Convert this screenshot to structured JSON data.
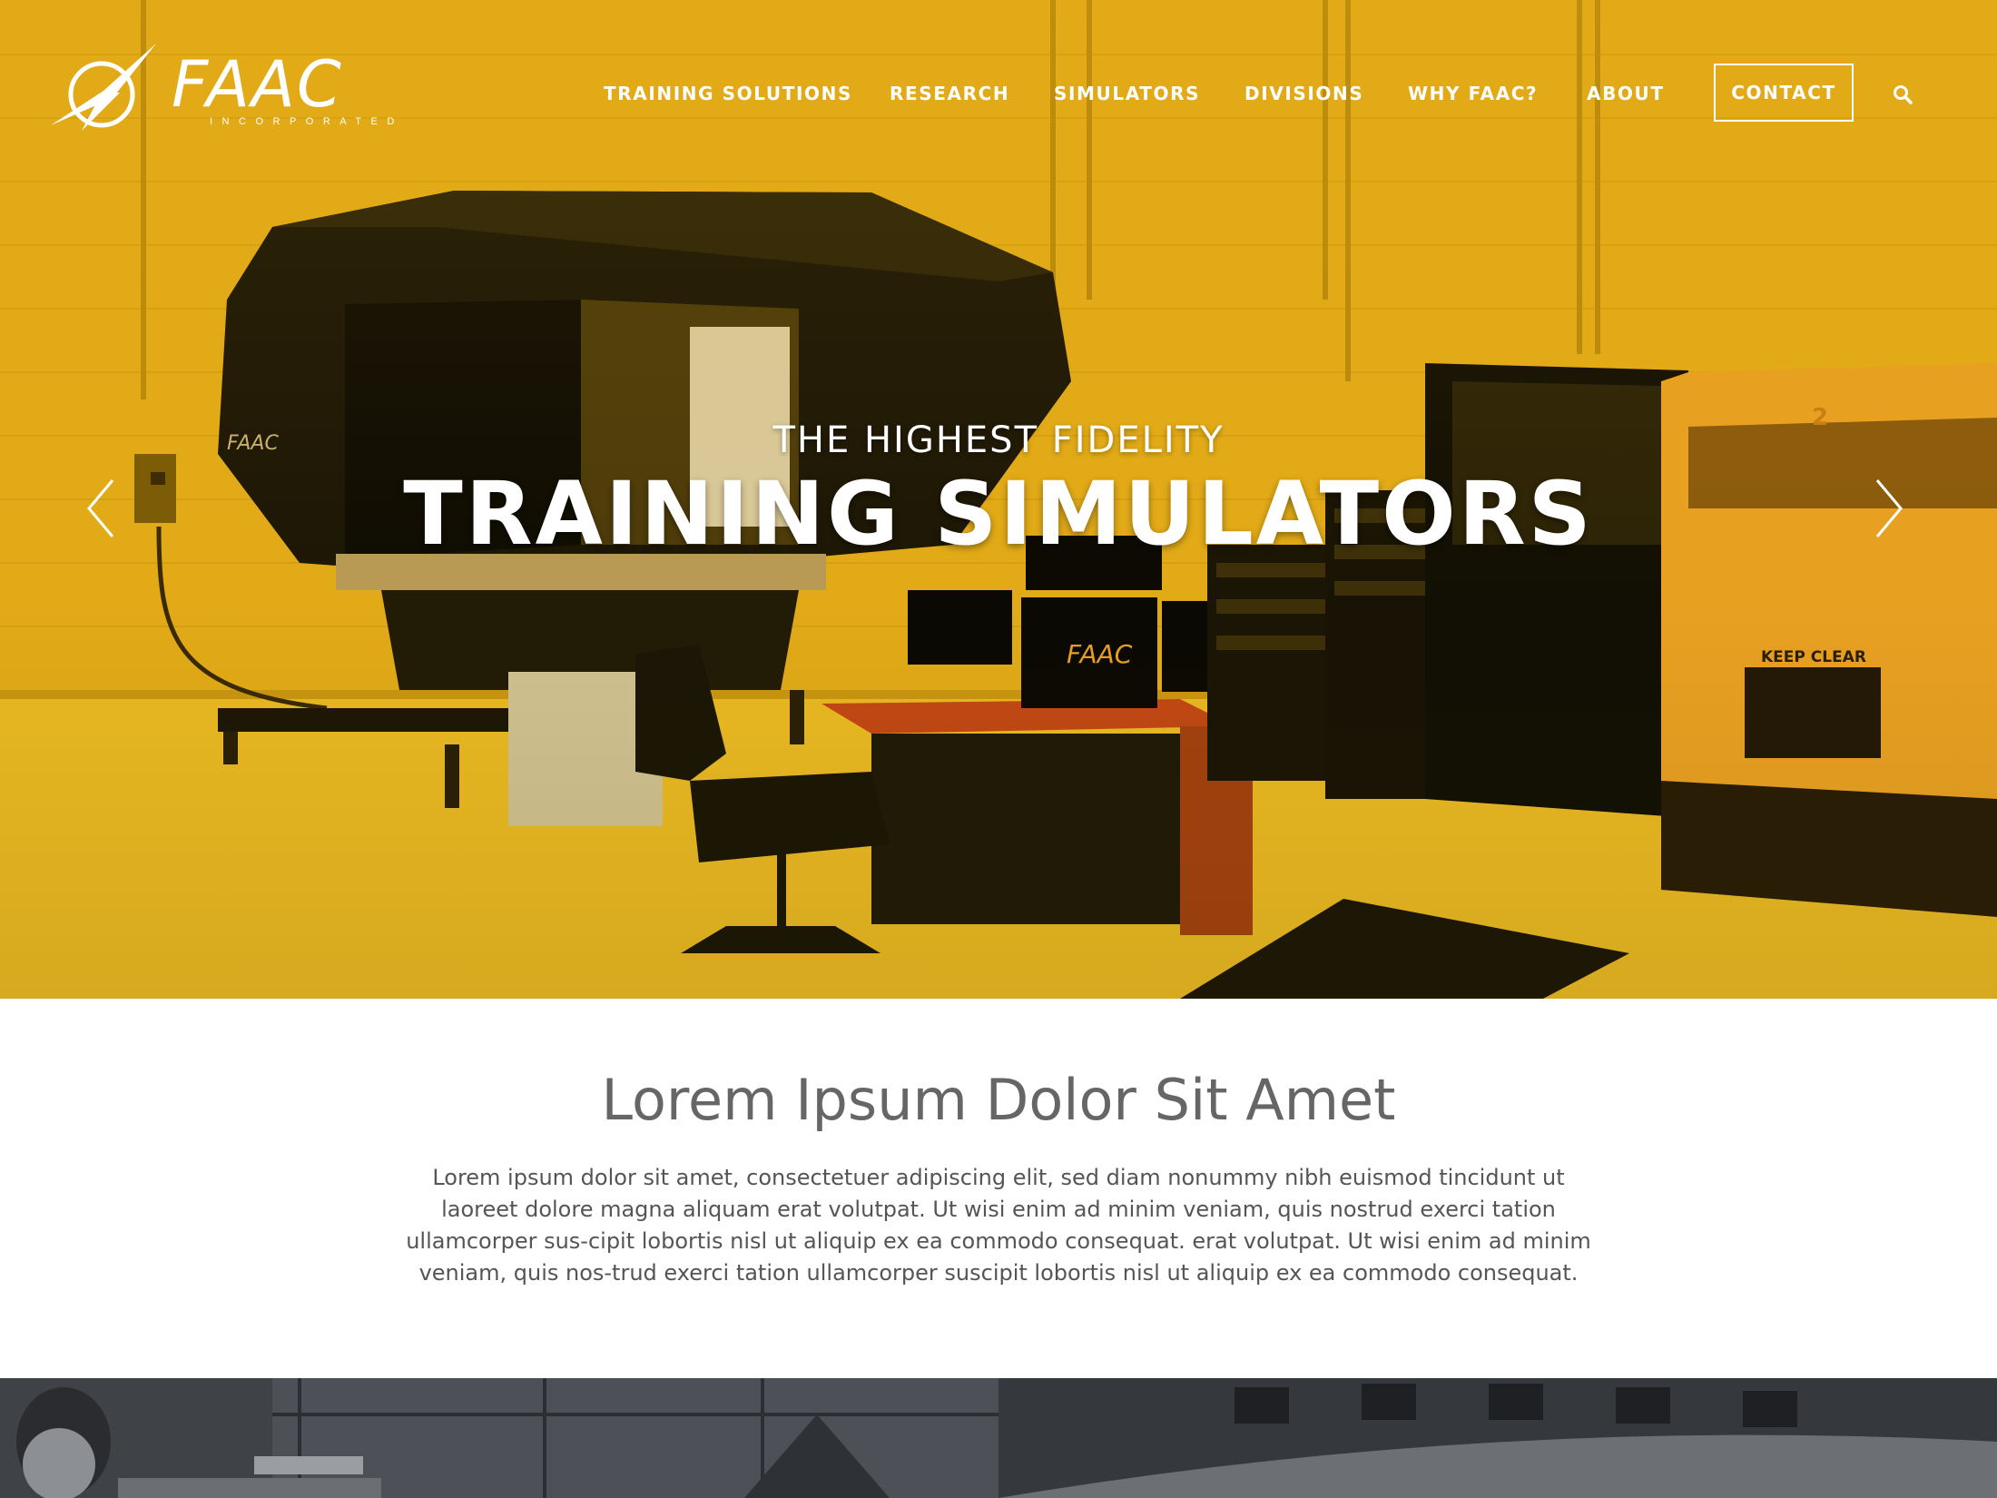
{
  "brand": {
    "name": "FAAC",
    "subtitle": "INCORPORATED"
  },
  "nav": {
    "items": [
      "TRAINING SOLUTIONS",
      "RESEARCH",
      "SIMULATORS",
      "DIVISIONS",
      "WHY FAAC?",
      "ABOUT"
    ],
    "contact_label": "CONTACT"
  },
  "hero": {
    "kicker": "THE HIGHEST FIDELITY",
    "title": "TRAINING SIMULATORS",
    "prev_icon": "chevron-left-icon",
    "next_icon": "chevron-right-icon",
    "tint_color": "#e3aa17"
  },
  "intro": {
    "title": "Lorem Ipsum Dolor Sit Amet",
    "body": "Lorem ipsum dolor sit amet, consectetuer adipiscing elit, sed diam nonummy nibh euismod tincidunt ut laoreet dolore magna aliquam erat volutpat. Ut wisi enim ad minim veniam, quis nostrud exerci tation ullamcorper sus-cipit lobortis nisl ut aliquip ex ea commodo consequat. erat volutpat. Ut wisi enim ad minim veniam, quis nos-trud exerci tation ullamcorper suscipit lobortis nisl ut aliquip ex ea commodo consequat."
  },
  "photo_text": {
    "machine_logo": "FAAC",
    "monitor_logo": "FAAC",
    "unit_number": "2",
    "unit_sign": "KEEP CLEAR"
  }
}
